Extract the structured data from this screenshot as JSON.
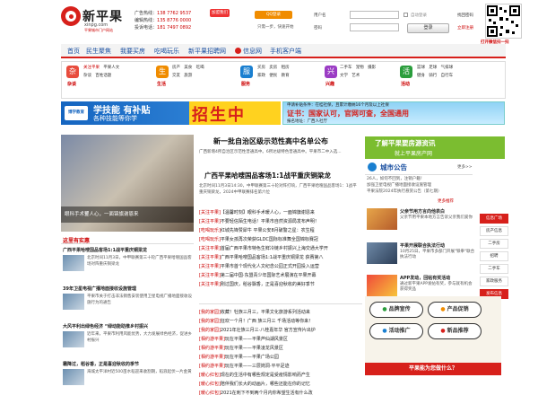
{
  "header": {
    "logo_text": "新平果",
    "logo_url": "xinpg.com",
    "logo_slogan": "平果城市门户网站",
    "phones": [
      {
        "label": "广告热线：",
        "number": "138 7762 9537"
      },
      {
        "label": "编辑热线：",
        "number": "135 8776 0000"
      },
      {
        "label": "投诉电话：",
        "number": "181 7497 0892"
      }
    ],
    "join_label": "加盟我们",
    "qq_label": "QQ登录",
    "wx_note": "只需一步，快速开始",
    "username_label": "用户名",
    "password_label": "密码",
    "auto_login": "自动登录",
    "retrieve_pw": "找回密码",
    "login_btn": "登录",
    "register": "立即注册",
    "qr_caption": "打开微信扫一扫"
  },
  "nav": [
    "首页",
    "民生聚焦",
    "我要买房",
    "吃喝玩乐",
    "新平果招聘网",
    "信息网",
    "手机客户端"
  ],
  "categories": [
    {
      "icon": "杂",
      "name": "杂谈",
      "links": [
        "关注平果",
        "平果人文",
        "杂谈",
        "百姓话题"
      ]
    },
    {
      "icon": "生",
      "name": "生活",
      "links": [
        "房产",
        "美食",
        "吃喝",
        "交友",
        "旅游"
      ]
    },
    {
      "icon": "服",
      "name": "服务",
      "links": [
        "买房",
        "卖房",
        "租房",
        "家政",
        "便民",
        "教育"
      ]
    },
    {
      "icon": "兴",
      "name": "兴趣",
      "links": [
        "二手车",
        "宠物",
        "摄影",
        "文学",
        "艺术"
      ]
    },
    {
      "icon": "活",
      "name": "活动",
      "links": [
        "篮球",
        "足球",
        "气排球",
        "健身",
        "骑行",
        "自行车"
      ]
    }
  ],
  "banner": {
    "left_brand": "博学教育",
    "left_title": "学技能 有补贴",
    "left_sub": "各种技能等你学",
    "middle": "招生中",
    "right_line1": "申请补贴条件：在桂社保，且累计缴纳16个月及以上社保",
    "right_line2": "证书：国家认可，官网可查，全国通用",
    "right_line3": "报名地址：广西人社厅"
  },
  "photo_caption": "眼科手术矍人心，一面锦旗谢恩来",
  "left_section": {
    "title": "这里有实惠",
    "items": [
      {
        "title": "广西平果哈嗖国品客场1:1战平重庆铜梁龙",
        "desc": "北京时间11月3日，中甲联赛第三十轮广西平果哈嗖国品客场对阵重庆铜梁龙"
      },
      {
        "title": "39年卫星电视广播地面接收设施管理",
        "desc": "平果市关于打击非法销售安装使用卫星电视广播地面接收设施行为的通告"
      },
      {
        "title": "大风平利出绿色经济 “绿动能助推乡村振兴",
        "desc": "近年来，平果市利用风能优势，大力发展绿色经济，促进乡村振兴"
      },
      {
        "title": "霜降过，稻谷香，正是喜迎秋收的季节",
        "desc": "海城太平洋村近500亩水稻迎来收割期，稻浪起伏一片金黄"
      }
    ]
  },
  "headline": {
    "title": "新一批自治区级示范性高中名单公布",
    "summary": "广西新增4所自治区示范性普通高中。6所达级特色普通高中。平果市二中入选...",
    "title2": "广西平果哈嗖国品客场1:1战平重庆铜梁龙",
    "summary2": "北京时间11月3日14:30，中甲联赛第三十轮对阵打响，广西平果哈嗖国品客场1：1战平重庆铜梁龙，2024中甲联赛排名第六位",
    "list": [
      {
        "tag": "[关注平果]",
        "text": "【温馨时刻】眼科手术暖人心，一面锦旗谢恩来"
      },
      {
        "tag": "[关注平果]",
        "text": "不要轻信陌生电话！平果市自然资源局发布声明！"
      },
      {
        "tag": "[吃喝玩乐]",
        "text": "红城先锋赞犀牛 平果公安8月破警之星：农生程"
      },
      {
        "tag": "[吃喝玩乐]",
        "text": "平果女孩再次荣获GLDC国际标准舞全国锦标赛冠"
      },
      {
        "tag": "[关注平果]",
        "text": "首届广西平果市特色生鲜冷链乡村振兴上海交通大学开"
      },
      {
        "tag": "[关注平果]",
        "text": "广西平果哈嗖国品客场1:1战平重庆铜梁龙 获赛第八"
      },
      {
        "tag": "[关注平果]",
        "text": "平果市首个现代化人文纪念公园正式开园投入运营"
      },
      {
        "tag": "[关注平果]",
        "text": "第二届中国·东盟青少年国际艺术展演在平果开幕"
      },
      {
        "tag": "[关注平果]",
        "text": "刚过国庆，稻谷飘香，正是喜迎秋收的美好季节"
      }
    ],
    "list2": [
      {
        "tag": "[我的家园]",
        "text": "收藏！牡族三月三，平果文化旅游系列活动来"
      },
      {
        "tag": "[我的家园]",
        "text": "狂欢一个月！广西 族三月三 千场活动等你来！"
      },
      {
        "tag": "[我的家园]",
        "text": "2021年壮族三月三·八桂嘉年华 官方宣传片出炉"
      },
      {
        "tag": "[相约游平果]",
        "text": "玩在平果——平果芦仙湖风景区"
      },
      {
        "tag": "[相约游平果]",
        "text": "玩在平果——平果凌龙风景区"
      },
      {
        "tag": "[相约游平果]",
        "text": "玩在平果——平果广场公园"
      },
      {
        "tag": "[相约游平果]",
        "text": "玩在平果——三层岗洞·平平足迹"
      },
      {
        "tag": "[暖心红包]",
        "text": "现在的生活中有哪些规定是受疫情影响而产生"
      },
      {
        "tag": "[暖心红包]",
        "text": "陪伴我们长大的动画片，哪些还能在你的记忆"
      },
      {
        "tag": "[暖心红包]",
        "text": "2021在刺下不到两个月内你希望生活有什么改"
      }
    ]
  },
  "right": {
    "ban_title": "了解平果要房源资讯",
    "ban_sub": "就上平果房产网",
    "city_title": "城市公告",
    "more": "更多>>",
    "notices": [
      "26人，如何不回到，注销户籍！",
      "加强卫星电视广播地面接收设施管理",
      "平果法院2024年执行悬赏公告（第七期）"
    ],
    "more_rec": "更多推荐",
    "items": [
      {
        "title": "父亲节用方言向他表白",
        "desc": "父亲节用平果本地方言告诉父亲我们爱你"
      },
      {
        "title": "平果开展联合执法行动",
        "desc": "10月25日，平果市多部门开展\"铁拳\"联合执法行动"
      },
      {
        "title": "APP发动，回帖有奖活动",
        "desc": "通过新平果APP发帖有奖，参与就有机会获得奖品"
      }
    ],
    "side_items": [
      "信息广场",
      "房产信息",
      "二手房",
      "招聘",
      "二手车",
      "家政服务",
      "发布信息"
    ],
    "promo_btns": [
      "品牌宣传",
      "产品促销",
      "活动推广",
      "新品推荐"
    ],
    "promo_bottom": "平果能为您做什么？"
  }
}
